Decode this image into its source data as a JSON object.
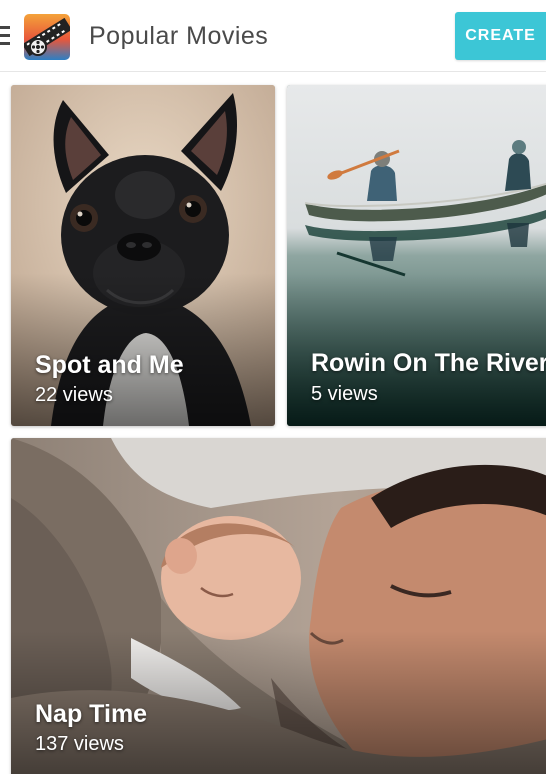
{
  "header": {
    "title": "Popular Movies",
    "create_label": "CREATE",
    "menu_icon": "hamburger-menu-icon",
    "logo_icon": "film-reel-logo-icon",
    "accent_color": "#3cc6d6"
  },
  "movies": [
    {
      "title": "Spot and Me",
      "views": "22 views",
      "thumbnail": "french-bulldog-photo"
    },
    {
      "title": "Rowin On The River",
      "views": "5 views",
      "thumbnail": "canoe-on-river-photo"
    },
    {
      "title": "Nap Time",
      "views": "137 views",
      "thumbnail": "father-and-baby-sleeping-photo"
    }
  ]
}
